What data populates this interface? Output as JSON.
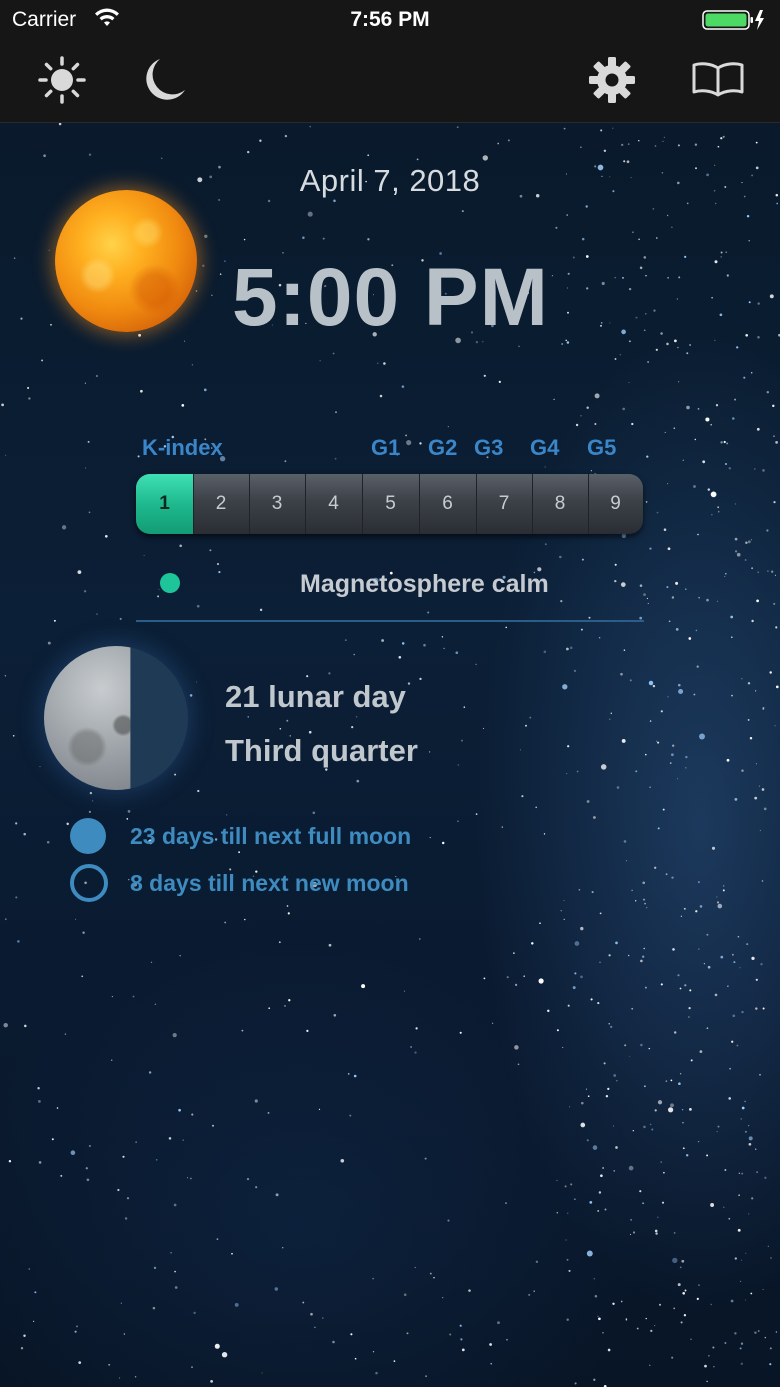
{
  "status_bar": {
    "carrier": "Carrier",
    "time": "7:56 PM"
  },
  "toolbar": {
    "icons": [
      "sun-icon",
      "moon-icon",
      "gear-icon",
      "book-icon"
    ]
  },
  "main": {
    "date": "April 7, 2018",
    "time": "5:00 PM"
  },
  "kindex": {
    "label": "K-index",
    "g_levels": [
      "G1",
      "G2",
      "G3",
      "G4",
      "G5"
    ],
    "values": [
      "1",
      "2",
      "3",
      "4",
      "5",
      "6",
      "7",
      "8",
      "9"
    ],
    "active_value": 1,
    "status_text": "Magnetosphere calm",
    "status_color": "#1fc59a"
  },
  "moon": {
    "lunar_day": "21 lunar day",
    "phase": "Third quarter",
    "full_moon_text": "23 days till next full moon",
    "new_moon_text": "8 days till next new moon"
  },
  "colors": {
    "accent_blue": "#3e8bc0",
    "kindex_active": "#1fb98e"
  }
}
